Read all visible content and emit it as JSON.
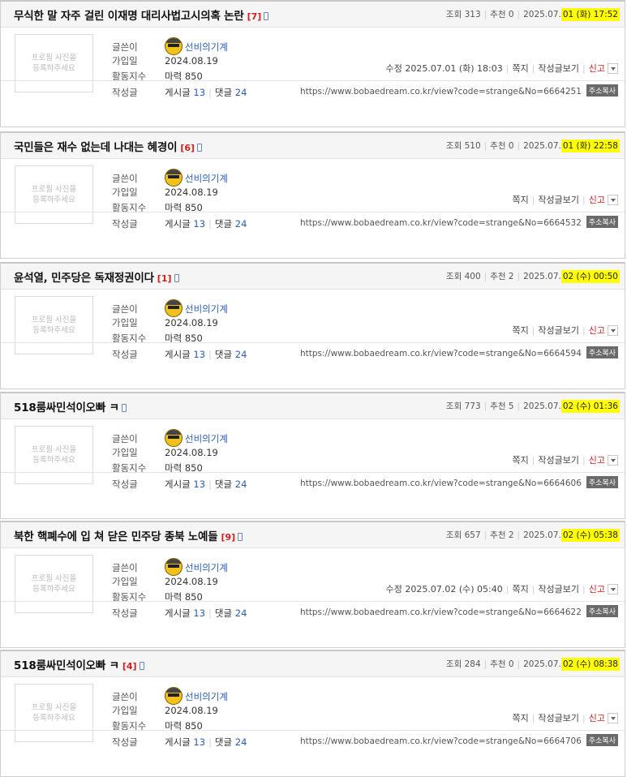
{
  "labels": {
    "views": "조회",
    "recommend": "추천",
    "author": "글쓴이",
    "join_date": "가입일",
    "activity": "활동지수",
    "posts_written": "작성글",
    "posts": "게시글",
    "comments": "댓글",
    "message": "쪽지",
    "view_posts": "작성글보기",
    "report": "신고",
    "copy_url": "주소복사",
    "profile_placeholder": "프로필 사진을\n등록하주세요"
  },
  "author": {
    "nickname": "선비의기계",
    "join_date": "2024.08.19",
    "activity": "마력 850",
    "post_count": "13",
    "comment_count": "24"
  },
  "posts": [
    {
      "title": "무식한 말 자주 걸린 이재명 대리사법고시의혹 논란",
      "comments": "[7]",
      "views": "313",
      "recommend": "0",
      "date_prefix": "2025.07.",
      "date_hl": "01 (화) 17:52",
      "edited": "수정 2025.07.01 (화) 18:03",
      "url": "https://www.bobaedream.co.kr/view?code=strange&No=6664251"
    },
    {
      "title": "국민들은 재수 없는데 나대는 혜경이",
      "comments": "[6]",
      "views": "510",
      "recommend": "0",
      "date_prefix": "2025.07.",
      "date_hl": "01 (화) 22:58",
      "edited": "",
      "url": "https://www.bobaedream.co.kr/view?code=strange&No=6664532"
    },
    {
      "title": "윤석열, 민주당은 독재정권이다",
      "comments": "[1]",
      "views": "400",
      "recommend": "2",
      "date_prefix": "2025.07.",
      "date_hl": "02 (수) 00:50",
      "edited": "",
      "url": "https://www.bobaedream.co.kr/view?code=strange&No=6664594"
    },
    {
      "title": "518룸싸민석이오빠 ㅋ",
      "comments": "",
      "views": "773",
      "recommend": "5",
      "date_prefix": "2025.07.",
      "date_hl": "02 (수) 01:36",
      "edited": "",
      "url": "https://www.bobaedream.co.kr/view?code=strange&No=6664606"
    },
    {
      "title": "북한 핵폐수에 입 쳐 닫은 민주당 종북 노예들",
      "comments": "[9]",
      "views": "657",
      "recommend": "2",
      "date_prefix": "2025.07.",
      "date_hl": "02 (수) 05:38",
      "edited": "수정 2025.07.02 (수) 05:40",
      "url": "https://www.bobaedream.co.kr/view?code=strange&No=6664622"
    },
    {
      "title": "518룸싸민석이오빠 ㅋ",
      "comments": "[4]",
      "views": "284",
      "recommend": "0",
      "date_prefix": "2025.07.",
      "date_hl": "02 (수) 08:38",
      "edited": "",
      "url": "https://www.bobaedream.co.kr/view?code=strange&No=6664706"
    }
  ]
}
